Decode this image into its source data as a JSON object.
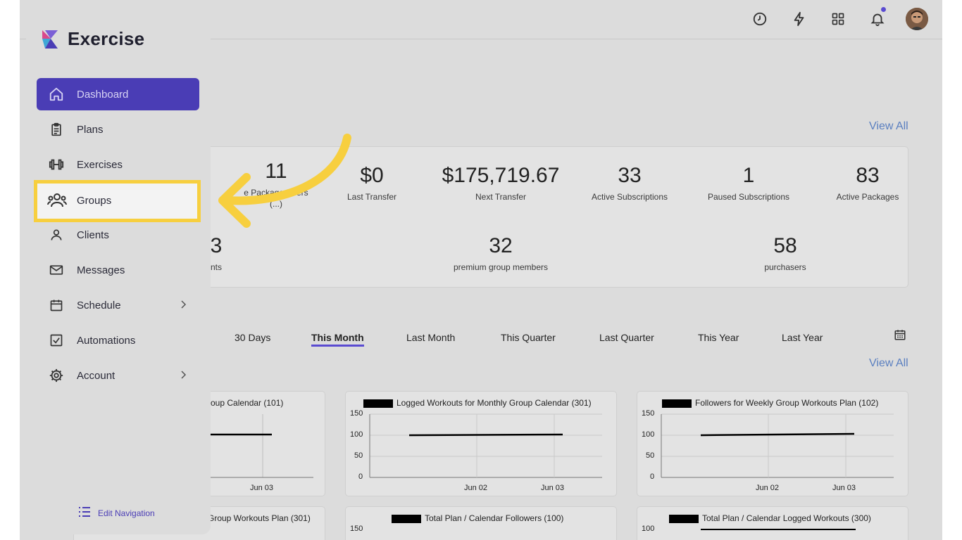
{
  "brand": {
    "name": "Exercise"
  },
  "sidebar": {
    "items": [
      {
        "label": "Dashboard",
        "icon": "home-icon"
      },
      {
        "label": "Plans",
        "icon": "clipboard-icon"
      },
      {
        "label": "Exercises",
        "icon": "dumbbell-icon"
      },
      {
        "label": "Groups",
        "icon": "users-icon"
      },
      {
        "label": "Clients",
        "icon": "user-icon"
      },
      {
        "label": "Messages",
        "icon": "mail-icon"
      },
      {
        "label": "Schedule",
        "icon": "calendar-icon"
      },
      {
        "label": "Automations",
        "icon": "checkbox-icon"
      },
      {
        "label": "Account",
        "icon": "gear-icon"
      }
    ],
    "edit_nav_label": "Edit Navigation"
  },
  "stats": {
    "view_all": "View All",
    "top": [
      {
        "value": "11",
        "label": "e Package Users",
        "label2": "(...)"
      },
      {
        "value": "$0",
        "label": "Last Transfer"
      },
      {
        "value": "$175,719.67",
        "label": "Next Transfer"
      },
      {
        "value": "33",
        "label": "Active Subscriptions"
      },
      {
        "value": "1",
        "label": "Paused Subscriptions"
      },
      {
        "value": "83",
        "label": "Active Packages"
      }
    ],
    "bottom": [
      {
        "value": "3",
        "label": "nts"
      },
      {
        "value": "32",
        "label": "premium group members"
      },
      {
        "value": "58",
        "label": "purchasers"
      }
    ]
  },
  "periods": {
    "items": [
      "30 Days",
      "This Month",
      "Last Month",
      "This Quarter",
      "Last Quarter",
      "This Year",
      "Last Year"
    ],
    "active": "This Month",
    "view_all": "View All"
  },
  "charts": [
    {
      "title": "roup Calendar (101)",
      "x_ticks": [
        "Jun 03"
      ]
    },
    {
      "title": "Logged Workouts for Monthly Group Calendar (301)",
      "y_ticks": [
        "150",
        "100",
        "50",
        "0"
      ],
      "x_ticks": [
        "Jun 02",
        "Jun 03"
      ]
    },
    {
      "title": "Followers for Weekly Group Workouts Plan (102)",
      "y_ticks": [
        "150",
        "100",
        "50",
        "0"
      ],
      "x_ticks": [
        "Jun 02",
        "Jun 03"
      ]
    },
    {
      "title": "Group Workouts Plan (301)"
    },
    {
      "title": "Total Plan / Calendar Followers (100)",
      "y_ticks": [
        "150"
      ]
    },
    {
      "title": "Total Plan / Calendar Logged Workouts (300)",
      "y_ticks": [
        "100"
      ]
    }
  ],
  "chart_data": [
    {
      "type": "line",
      "title": "roup Calendar (101)",
      "x": [
        "Jun 03"
      ],
      "series": [
        {
          "values": [
            100
          ]
        }
      ]
    },
    {
      "type": "line",
      "title": "Logged Workouts for Monthly Group Calendar (301)",
      "x": [
        "Jun 02",
        "Jun 03"
      ],
      "series": [
        {
          "values": [
            100,
            101
          ]
        }
      ],
      "ylim": [
        0,
        150
      ]
    },
    {
      "type": "line",
      "title": "Followers for Weekly Group Workouts Plan (102)",
      "x": [
        "Jun 02",
        "Jun 03"
      ],
      "series": [
        {
          "values": [
            100,
            102
          ]
        }
      ],
      "ylim": [
        0,
        150
      ]
    }
  ],
  "colors": {
    "accent": "#4a3db5",
    "highlight": "#f7cf3f"
  }
}
